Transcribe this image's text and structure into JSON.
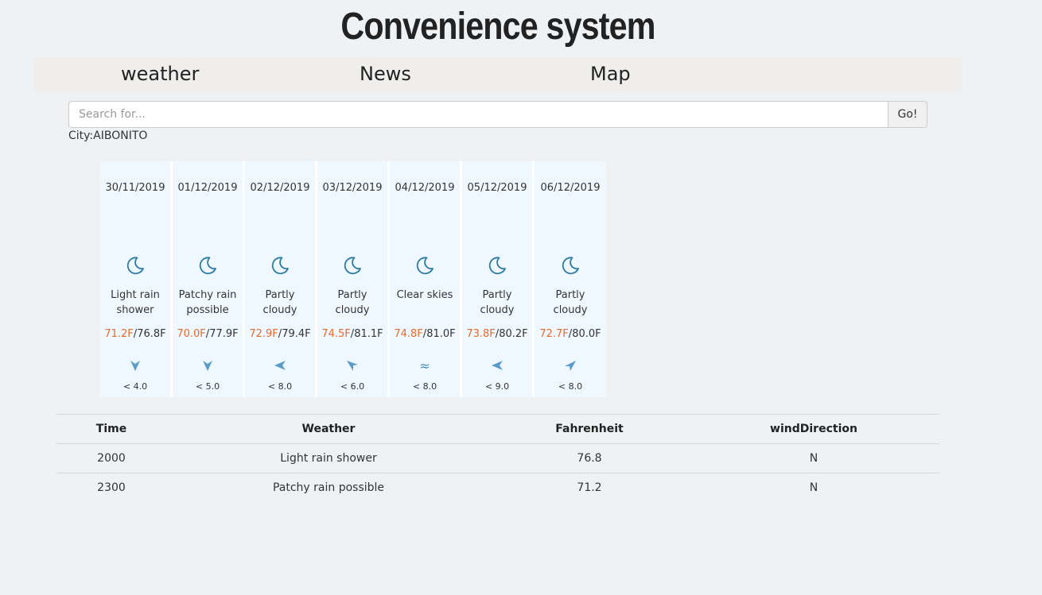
{
  "app": {
    "title": "Convenience system"
  },
  "nav": {
    "items": [
      {
        "label": "weather"
      },
      {
        "label": "News"
      },
      {
        "label": "Map"
      }
    ]
  },
  "search": {
    "placeholder": "Search for...",
    "value": "",
    "button_label": "Go!"
  },
  "city": {
    "label": "City:AIBONITO"
  },
  "forecast": [
    {
      "date": "30/11/2019",
      "icon": "moon-icon",
      "desc_line1": "Light rain",
      "desc_line2": "shower",
      "low": "71.2F",
      "sep": "/",
      "high": "76.8F",
      "wind_icon": "arrow-down-icon",
      "wind": "< 4.0"
    },
    {
      "date": "01/12/2019",
      "icon": "moon-icon",
      "desc_line1": "Patchy rain",
      "desc_line2": "possible",
      "low": "70.0F",
      "sep": "/",
      "high": "77.9F",
      "wind_icon": "arrow-down-icon",
      "wind": "< 5.0"
    },
    {
      "date": "02/12/2019",
      "icon": "moon-icon",
      "desc_line1": "Partly",
      "desc_line2": "cloudy",
      "low": "72.9F",
      "sep": "/",
      "high": "79.4F",
      "wind_icon": "arrow-left-icon",
      "wind": "< 8.0"
    },
    {
      "date": "03/12/2019",
      "icon": "moon-icon",
      "desc_line1": "Partly",
      "desc_line2": "cloudy",
      "low": "74.5F",
      "sep": "/",
      "high": "81.1F",
      "wind_icon": "arrow-up-left-icon",
      "wind": "< 6.0"
    },
    {
      "date": "04/12/2019",
      "icon": "moon-icon",
      "desc_line1": "Clear skies",
      "desc_line2": "",
      "low": "74.8F",
      "sep": "/",
      "high": "81.0F",
      "wind_icon": "wind-waves-icon",
      "wind": "< 8.0"
    },
    {
      "date": "05/12/2019",
      "icon": "moon-icon",
      "desc_line1": "Partly",
      "desc_line2": "cloudy",
      "low": "73.8F",
      "sep": "/",
      "high": "80.2F",
      "wind_icon": "arrow-left-icon",
      "wind": "< 9.0"
    },
    {
      "date": "06/12/2019",
      "icon": "moon-icon",
      "desc_line1": "Partly",
      "desc_line2": "cloudy",
      "low": "72.7F",
      "sep": "/",
      "high": "80.0F",
      "wind_icon": "arrow-up-right-icon",
      "wind": "< 8.0"
    }
  ],
  "table": {
    "headers": [
      "Time",
      "Weather",
      "Fahrenheit",
      "windDirection"
    ],
    "rows": [
      [
        "2000",
        "Light rain shower",
        "76.8",
        "N"
      ],
      [
        "2300",
        "Patchy rain possible",
        "71.2",
        "N"
      ]
    ]
  },
  "colors": {
    "low_temp": "#e86a2b",
    "icon": "#2a7ca6",
    "card_bg": "#f0f8ff"
  }
}
